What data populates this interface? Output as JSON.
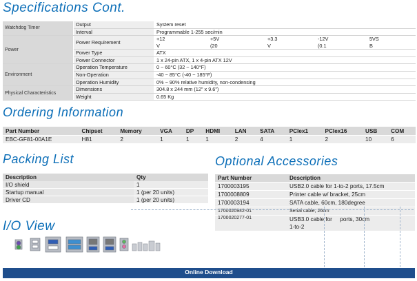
{
  "headings": {
    "specifications": "Specifications Cont.",
    "ordering": "Ordering Information",
    "packing": "Packing List",
    "accessories": "Optional Accessories",
    "io": "I/O View"
  },
  "specs": {
    "watchdog": {
      "category": "Watchdog Timer",
      "rows": [
        {
          "label": "Output",
          "value": "System reset"
        },
        {
          "label": "Interval",
          "value": "Programmable 1-255 sec/min"
        }
      ]
    },
    "power": {
      "category": "Power",
      "requirement_label": "Power Requirement",
      "rails": [
        {
          "top": "+12",
          "bottom": "V"
        },
        {
          "top": "+5V",
          "bottom": "(20"
        },
        {
          "top": "+3.3",
          "bottom": "V"
        },
        {
          "top": "-12V",
          "bottom": "(0.1"
        },
        {
          "top": "5VS",
          "bottom": "B"
        }
      ],
      "rows": [
        {
          "label": "Power Type",
          "value": "ATX"
        },
        {
          "label": "Power Connector",
          "value": "1 x 24-pin ATX, 1 x 4-pin ATX 12V"
        }
      ]
    },
    "environment": {
      "category": "Environment",
      "rows": [
        {
          "label": "Operation Temperature",
          "value": "0 ~ 60°C (32 ~ 140°F)"
        },
        {
          "label": "Non-Operation",
          "value": "-40 ~ 85°C (-40 ~ 185°F)"
        },
        {
          "label": "Operation Humidity",
          "value": "0% ~ 90% relative humidity, non-condensing"
        }
      ]
    },
    "physical": {
      "category": "Physical Characteristics",
      "rows": [
        {
          "label": "Dimensions",
          "value": "304.8 x 244 mm (12\" x 9.6\")"
        },
        {
          "label": "Weight",
          "value": "0.65 Kg"
        }
      ]
    }
  },
  "ordering": {
    "headers": [
      "Part Number",
      "Chipset",
      "Memory",
      "VGA",
      "DP",
      "HDMI",
      "LAN",
      "SATA",
      "PCIex1",
      "PCIex16",
      "USB",
      "COM"
    ],
    "row": [
      "EBC-GF81-00A1E",
      "H81",
      "2",
      "1",
      "1",
      "1",
      "2",
      "4",
      "1",
      "2",
      "10",
      "6"
    ]
  },
  "packing": {
    "headers": [
      "Description",
      "Qty"
    ],
    "rows": [
      {
        "description": "I/O shield",
        "qty": "1"
      },
      {
        "description": "Startup manual",
        "qty": "1 (per 20 units)"
      },
      {
        "description": "Driver CD",
        "qty": "1 (per 20 units)"
      }
    ]
  },
  "accessories": {
    "headers": [
      "Part Number",
      "Description"
    ],
    "rows": [
      {
        "part": "1700003195",
        "description": "USB2.0 cable for 1-to-2 ports, 17.5cm"
      },
      {
        "part": "1700008809",
        "description": "Printer cable w/ bracket, 25cm"
      },
      {
        "part": "1700003194",
        "description": "SATA cable, 60cm, 180degree"
      },
      {
        "part": "1700020942-01",
        "description": "Serial cable, 26cm"
      },
      {
        "part": "1700020277-01",
        "description": "USB3.0 cable for     ports, 30cm",
        "description2": "1-to-2"
      }
    ]
  },
  "footer": {
    "download_label": "Online Download"
  },
  "colors": {
    "heading": "#0d6fb8",
    "footer_bar": "#1f4e8c"
  }
}
